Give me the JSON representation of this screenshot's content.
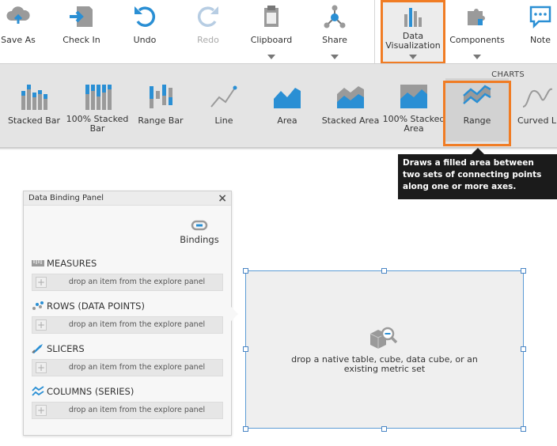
{
  "ribbon": {
    "save_as": "Save As",
    "check_in": "Check In",
    "undo": "Undo",
    "redo": "Redo",
    "clipboard": "Clipboard",
    "share": "Share",
    "data_visualization": "Data Visualization",
    "components": "Components",
    "note": "Note"
  },
  "gallery": {
    "header": "CHARTS",
    "items": [
      {
        "label": "Stacked Bar"
      },
      {
        "label": "100% Stacked Bar"
      },
      {
        "label": "Range Bar"
      },
      {
        "label": "Line"
      },
      {
        "label": "Area"
      },
      {
        "label": "Stacked Area"
      },
      {
        "label": "100% Stacked Area"
      },
      {
        "label": "Range"
      },
      {
        "label": "Curved Li"
      }
    ],
    "selected": "Range"
  },
  "tooltip": {
    "text": "Draws a filled area between two sets of connecting points along one or more axes."
  },
  "panel": {
    "title": "Data Binding Panel",
    "close_glyph": "×",
    "bindings_label": "Bindings",
    "sections": [
      {
        "label": "MEASURES",
        "placeholder": "drop an item from the explore panel"
      },
      {
        "label": "ROWS (DATA POINTS)",
        "placeholder": "drop an item from the explore panel"
      },
      {
        "label": "SLICERS",
        "placeholder": "drop an item from the explore panel"
      },
      {
        "label": "COLUMNS (SERIES)",
        "placeholder": "drop an item from the explore panel"
      }
    ]
  },
  "canvas": {
    "prompt": "drop a native table, cube, data cube, or an existing metric set"
  },
  "colors": {
    "accent": "#f07c24",
    "icon_blue": "#2a8fd4",
    "icon_gray": "#9a9a9a",
    "tooltip_bg": "#1b1b1b",
    "selection_border": "#5b9bd5"
  }
}
